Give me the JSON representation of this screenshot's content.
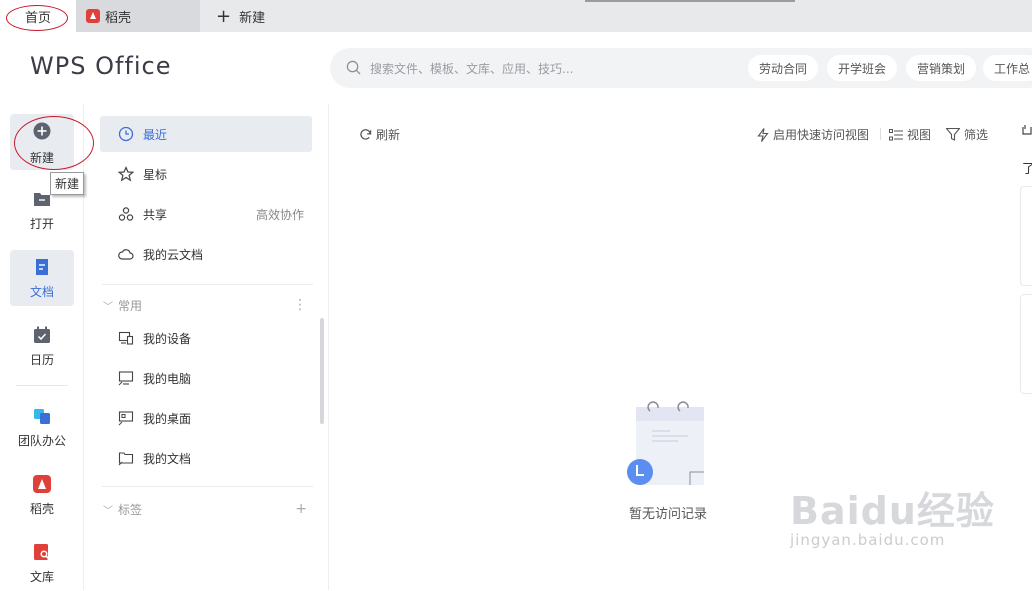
{
  "tabs": {
    "home": "首页",
    "daoke": "稻壳",
    "new_tab": "新建"
  },
  "header": {
    "logo": "WPS Office",
    "search_placeholder": "搜索文件、模板、文库、应用、技巧...",
    "chips": [
      "劳动合同",
      "开学班会",
      "营销策划",
      "工作总"
    ]
  },
  "rail": {
    "new": "新建",
    "open": "打开",
    "docs": "文档",
    "calendar": "日历",
    "team": "团队办公",
    "daoke": "稻壳",
    "library": "文库",
    "tooltip": "新建"
  },
  "nav": {
    "recent": "最近",
    "starred": "星标",
    "shared": "共享",
    "shared_extra": "高效协作",
    "cloud": "我的云文档",
    "common_header": "常用",
    "device": "我的设备",
    "computer": "我的电脑",
    "desktop": "我的桌面",
    "documents": "我的文档",
    "tags_header": "标签"
  },
  "toolbar": {
    "refresh": "刷新",
    "quick_view": "启用快速访问视图",
    "view": "视图",
    "filter": "筛选"
  },
  "main": {
    "empty_text": "暂无访问记录",
    "right_edge_text": "了"
  },
  "watermark": {
    "main": "Baidu经验",
    "sub": "jingyan.baidu.com"
  },
  "colors": {
    "accent": "#3a6fd8",
    "annotation": "#c8182a",
    "brand_red": "#e0403a"
  }
}
